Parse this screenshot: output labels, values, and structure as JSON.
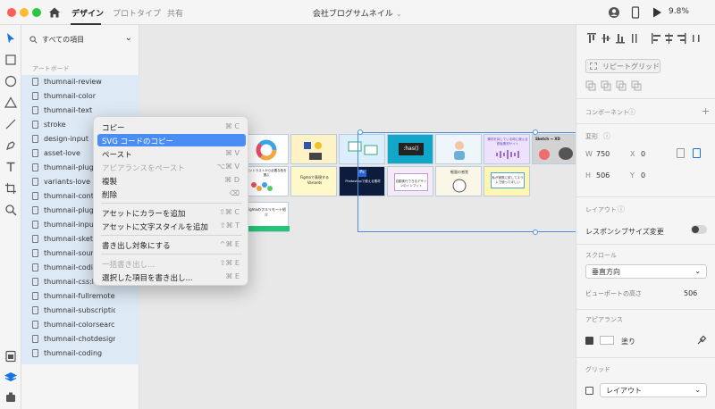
{
  "header": {
    "tabs": [
      {
        "label": "デザイン"
      },
      {
        "label": "プロトタイプ"
      },
      {
        "label": "共有"
      }
    ],
    "doc_title": "会社ブログサムネイル",
    "zoom": "9.8%"
  },
  "layers": {
    "search_placeholder": "すべての項目",
    "section_label": "アートボード",
    "items": [
      {
        "label": "thumnail-review"
      },
      {
        "label": "thumnail-color"
      },
      {
        "label": "thumnail-text"
      },
      {
        "label": "stroke"
      },
      {
        "label": "design-input"
      },
      {
        "label": "asset-love"
      },
      {
        "label": "thumnail-plugin-"
      },
      {
        "label": "variants-love"
      },
      {
        "label": "thumnail-contras"
      },
      {
        "label": "thumnail-plugin"
      },
      {
        "label": "thumnail-input"
      },
      {
        "label": "thumnail-sketcht"
      },
      {
        "label": "thumnail-sounds"
      },
      {
        "label": "thumnail-coding"
      },
      {
        "label": "thumnail-css:has"
      },
      {
        "label": "thumnail-fullremote"
      },
      {
        "label": "thumnail-subscription"
      },
      {
        "label": "thumnail-colorsearch"
      },
      {
        "label": "thumnail-chotdesign"
      },
      {
        "label": "thumnail-coding"
      }
    ]
  },
  "canvas": {
    "thumbnails": [
      {
        "label": ""
      },
      {
        "label": ""
      },
      {
        "label": ""
      },
      {
        "label": ":has()"
      },
      {
        "label": ""
      },
      {
        "label": "素材を探している時に使える鉄板素材サイト"
      },
      {
        "label": "Sketch → XD"
      },
      {
        "label": "コントラストから必要な色を選ぶ"
      },
      {
        "label": "Figmaで表現するVariants"
      },
      {
        "label": "Photoshopで使える素材"
      },
      {
        "label": "自動実行できるデザインのインプット"
      },
      {
        "label": "軽量の感覚"
      },
      {
        "label": "私が実際に試してスラムで使ってほしい"
      },
      {
        "label": ""
      },
      {
        "label": "Figmaのフルリモート紹介"
      }
    ]
  },
  "context_menu": {
    "items": [
      {
        "label": "コピー",
        "shortcut": "⌘ C"
      },
      {
        "label": "SVG コードのコピー",
        "shortcut": ""
      },
      {
        "label": "ペースト",
        "shortcut": "⌘ V"
      },
      {
        "label": "アピアランスをペースト",
        "shortcut": "⌥⌘ V"
      },
      {
        "label": "複製",
        "shortcut": "⌘ D"
      },
      {
        "label": "削除",
        "shortcut": "⌫"
      },
      {
        "label": "アセットにカラーを追加",
        "shortcut": "⇧⌘ C"
      },
      {
        "label": "アセットに文字スタイルを追加",
        "shortcut": "⇧⌘ T"
      },
      {
        "label": "書き出し対象にする",
        "shortcut": "^⌘ E"
      },
      {
        "label": "一括書き出し...",
        "shortcut": "⇧⌘ E"
      },
      {
        "label": "選択した項目を書き出し...",
        "shortcut": "⌘ E"
      }
    ]
  },
  "props": {
    "repeat_grid": "リピートグリッド",
    "component": "コンポーネント",
    "transform": "変形",
    "w_label": "W",
    "w_value": "750",
    "x_label": "X",
    "x_value": "0",
    "h_label": "H",
    "h_value": "506",
    "y_label": "Y",
    "y_value": "0",
    "layout": "レイアウト",
    "responsive": "レスポンシブサイズ変更",
    "scroll": "スクロール",
    "scroll_value": "垂直方向",
    "viewport_label": "ビューポートの高さ",
    "viewport_value": "506",
    "appearance": "アピアランス",
    "fill": "塗り",
    "grid": "グリッド",
    "grid_value": "レイアウト"
  },
  "colors": {
    "accent": "#4a8ef5",
    "traffic_red": "#fe5f57",
    "traffic_yellow": "#febc2e",
    "traffic_green": "#28c840"
  }
}
